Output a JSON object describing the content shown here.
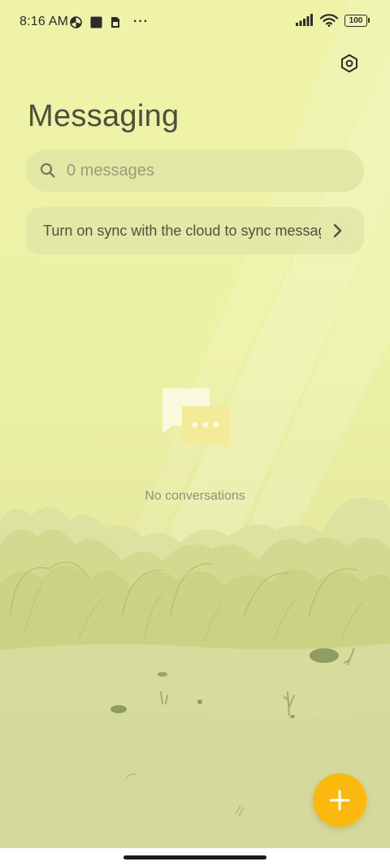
{
  "status_bar": {
    "time": "8:16 AM",
    "more": "···",
    "battery": "100",
    "icons": [
      "pie-chart-icon",
      "stop-square-icon",
      "sim-card-icon",
      "signal-bars-icon",
      "wifi-icon",
      "battery-icon"
    ]
  },
  "header": {
    "title": "Messaging",
    "settings_icon": "settings-hexagon-icon"
  },
  "search": {
    "placeholder": "0 messages",
    "value": "",
    "icon": "search-icon"
  },
  "sync_banner": {
    "text": "Turn on sync with the cloud to sync messages",
    "icon": "chevron-right-icon"
  },
  "empty_state": {
    "icon": "chat-bubbles-icon",
    "text": "No conversations"
  },
  "fab": {
    "icon": "plus-icon"
  },
  "colors": {
    "background_top": "#eef3a8",
    "background_bottom": "#d7db9b",
    "title_text": "#4b4f3c",
    "fab": "#fbb90f",
    "card": "#e2e7a6"
  }
}
